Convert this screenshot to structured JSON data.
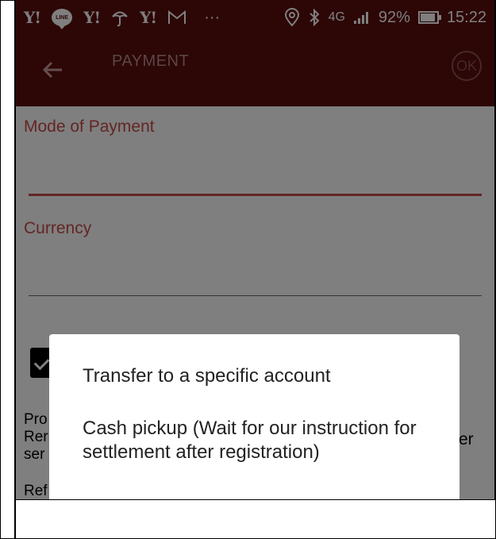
{
  "status_bar": {
    "notification_icons": [
      "yahoo-icon",
      "line-icon",
      "yahoo-icon",
      "umbrella-icon",
      "yahoo-icon",
      "gmail-icon"
    ],
    "yahoo_label": "Y!",
    "line_label": "LINE",
    "more": "···",
    "network": "4G",
    "battery": "92%",
    "time": "15:22"
  },
  "app_bar": {
    "title": "PAYMENT",
    "ok_label": "OK"
  },
  "form": {
    "mode_of_payment": {
      "label": "Mode of Payment",
      "value": ""
    },
    "currency": {
      "label": "Currency",
      "value": ""
    },
    "checkbox_checked": true,
    "partial_text": {
      "line1": "Pro",
      "line2": "Rer",
      "line2_right": "er",
      "line3": "ser",
      "line4": "Ref"
    }
  },
  "dialog": {
    "options": [
      "Transfer to a specific account",
      "Cash pickup (Wait for our instruction for settlement after registration)"
    ]
  },
  "colors": {
    "primary": "#5a0c0c",
    "accent": "#c94a4a"
  }
}
